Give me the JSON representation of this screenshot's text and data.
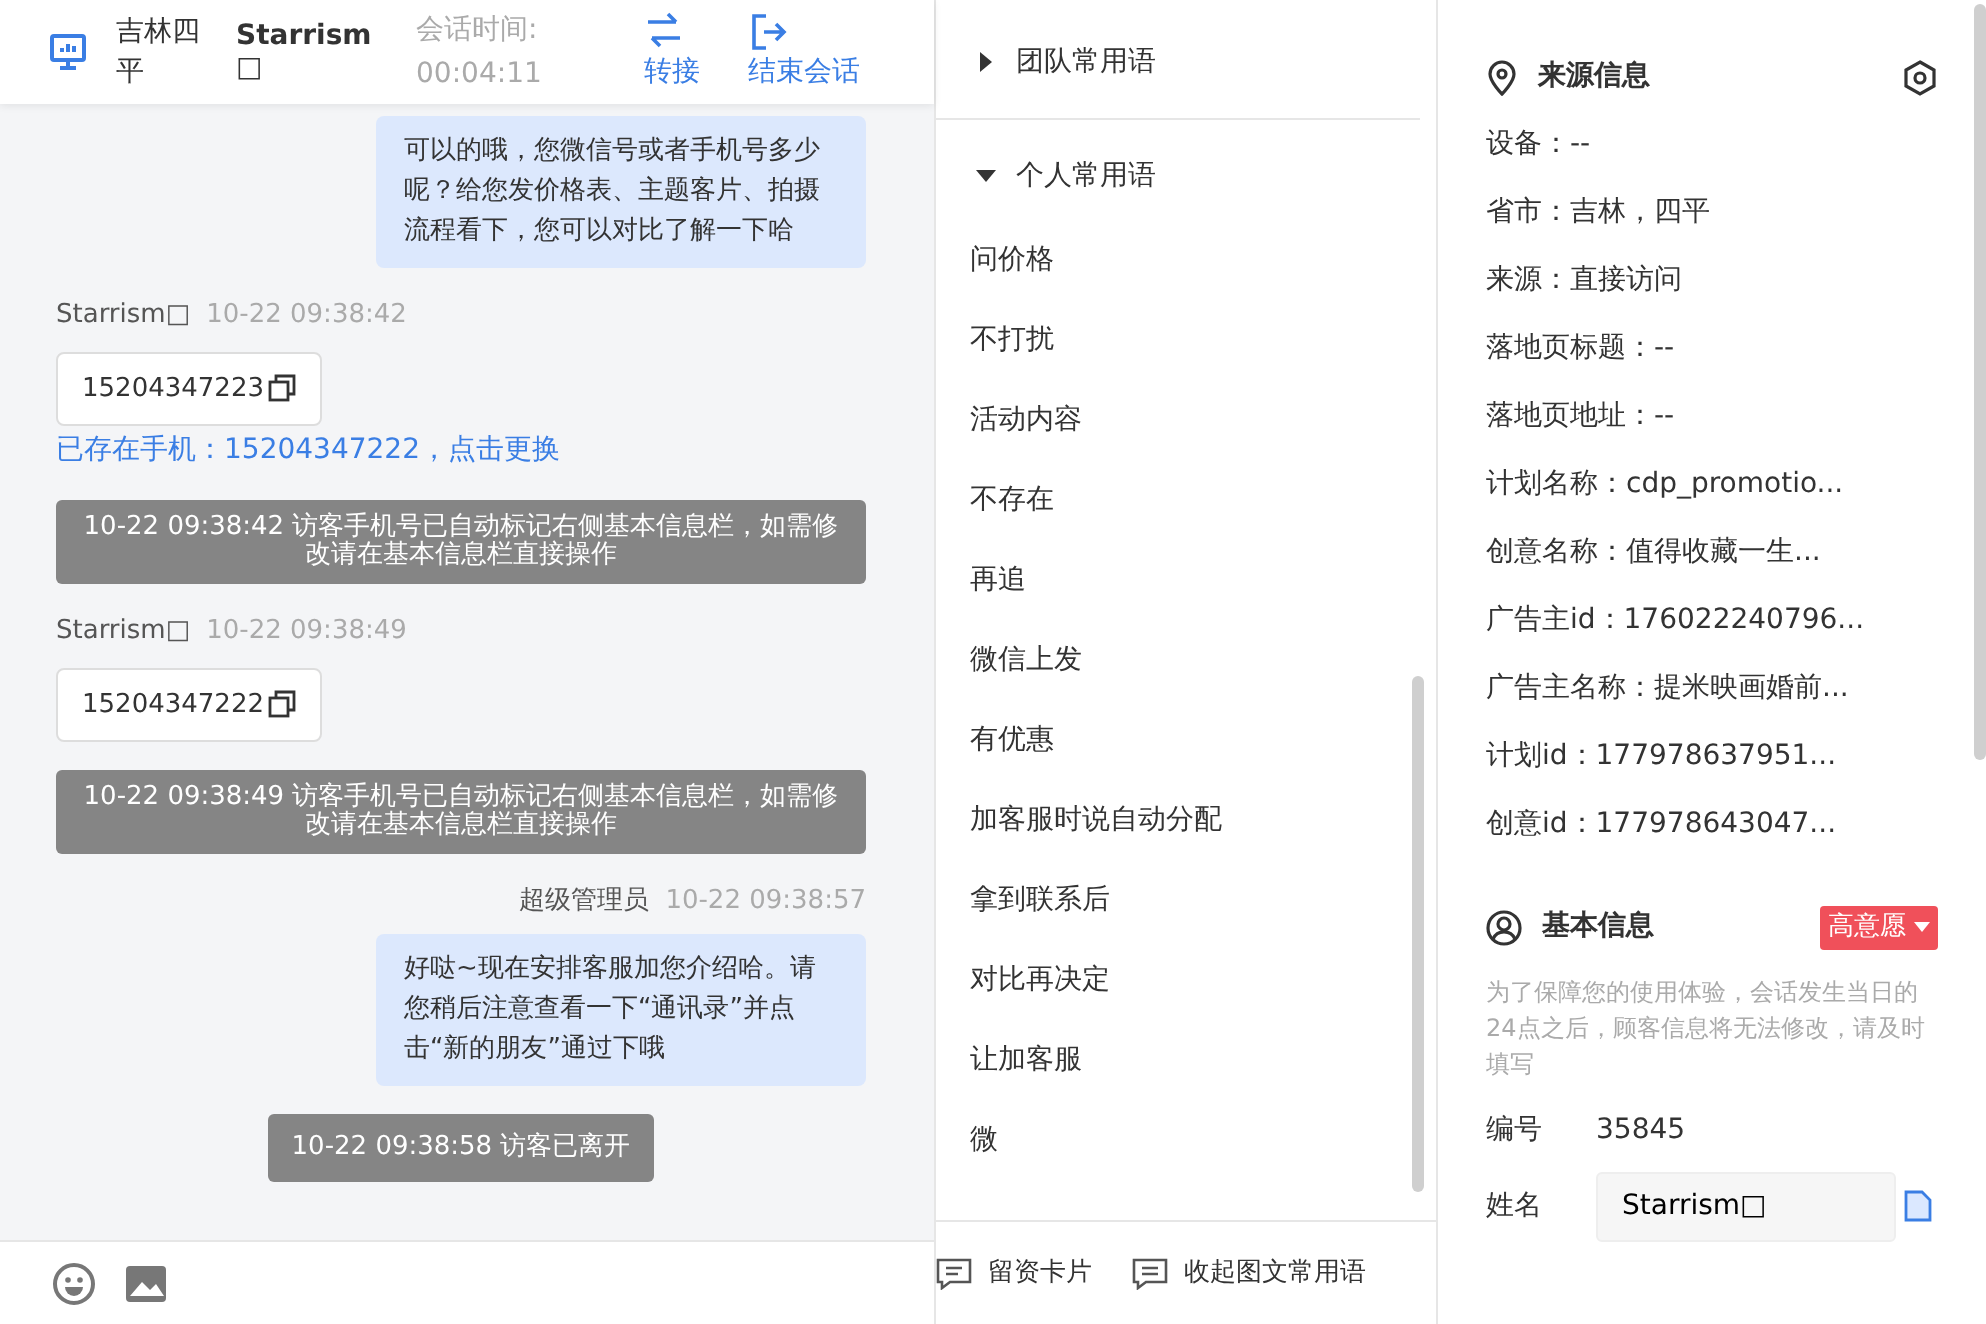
{
  "header": {
    "location": "吉林四平",
    "visitor_name": "Starrism□",
    "session_time_label": "会话时间:",
    "session_time": "00:04:11",
    "actions": [
      {
        "kind": "transfer",
        "label": "转接"
      },
      {
        "kind": "end",
        "label": "结束会话"
      }
    ]
  },
  "messages": [
    {
      "kind": "agent",
      "text": "可以的哦，您微信号或者手机号多少呢？给您发价格表、主题客片、拍摄流程看下，您可以对比了解一下哈"
    },
    {
      "kind": "visitor",
      "sender": "Starrism□",
      "time": "10-22 09:38:42",
      "phone": "15204347223",
      "link": "已存在手机：15204347222，点击更换"
    },
    {
      "kind": "system",
      "text": "10-22 09:38:42 访客手机号已自动标记右侧基本信息栏，如需修改请在基本信息栏直接操作"
    },
    {
      "kind": "visitor",
      "sender": "Starrism□",
      "time": "10-22 09:38:49",
      "phone": "15204347222"
    },
    {
      "kind": "system",
      "text": "10-22 09:38:49 访客手机号已自动标记右侧基本信息栏，如需修改请在基本信息栏直接操作"
    },
    {
      "kind": "agent",
      "sender": "超级管理员",
      "time": "10-22 09:38:57",
      "text": "好哒~现在安排客服加您介绍哈。请您稍后注意查看一下“通讯录”并点击“新的朋友”通过下哦"
    },
    {
      "kind": "system",
      "text": "10-22 09:38:58 访客已离开"
    }
  ],
  "phrases": [
    {
      "title": "团队常用语",
      "expanded": false
    },
    {
      "title": "个人常用语",
      "expanded": true,
      "items": [
        "问价格",
        "不打扰",
        "活动内容",
        "不存在",
        "再追",
        "微信上发",
        "有优惠",
        "加客服时说自动分配",
        "拿到联系后",
        "对比再决定",
        "让加客服",
        "微"
      ]
    }
  ],
  "phrase_footer": [
    {
      "kind": "card",
      "label": "留资卡片"
    },
    {
      "kind": "collapse",
      "label": "收起图文常用语"
    }
  ],
  "source_info": {
    "title": "来源信息",
    "fields": [
      "设备：--",
      "省市：吉林，四平",
      "来源：直接访问",
      "落地页标题：--",
      "落地页地址：--",
      "计划名称：cdp_promotio...",
      "创意名称：值得收藏一生...",
      "广告主id：176022240796...",
      "广告主名称：提米映画婚前...",
      "计划id：177978637951...",
      "创意id：177978643047..."
    ]
  },
  "basic_info": {
    "title": "基本信息",
    "intent_tag": "高意愿",
    "notice": "为了保障您的使用体验，会话发生当日的24点之后，顾客信息将无法修改，请及时填写",
    "fields": [
      {
        "kind": "text",
        "label": "编号",
        "value": "35845"
      },
      {
        "kind": "input",
        "label": "姓名",
        "value": "Starrism□"
      }
    ]
  }
}
